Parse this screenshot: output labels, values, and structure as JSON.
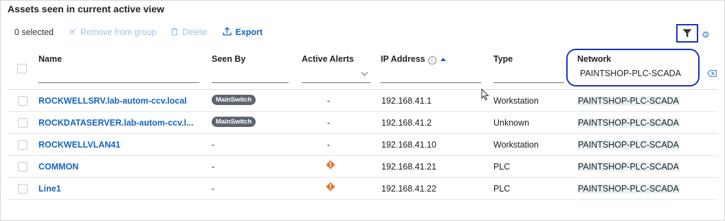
{
  "panel": {
    "title": "Assets seen in current active view"
  },
  "toolbar": {
    "selected": "0 selected",
    "remove_label": "Remove from group",
    "delete_label": "Delete",
    "export_label": "Export"
  },
  "columns": {
    "name": "Name",
    "seen_by": "Seen By",
    "active_alerts": "Active Alerts",
    "ip_address": "IP Address",
    "type": "Type",
    "network": "Network"
  },
  "filters": {
    "network_value": "PAINTSHOP-PLC-SCADA"
  },
  "rows": [
    {
      "name": "ROCKWELLSRV.lab-autom-ccv.local",
      "seen_by": "MainSwitch",
      "alerts": "-",
      "ip": "192.168.41.1",
      "type": "Workstation",
      "network": "PAINTSHOP-PLC-SCADA"
    },
    {
      "name": "ROCKDATASERVER.lab-autom-ccv.l...",
      "seen_by": "MainSwitch",
      "alerts": "-",
      "ip": "192.168.41.2",
      "type": "Unknown",
      "network": "PAINTSHOP-PLC-SCADA"
    },
    {
      "name": "ROCKWELLVLAN41",
      "seen_by": "-",
      "alerts": "-",
      "ip": "192.168.41.10",
      "type": "Workstation",
      "network": "PAINTSHOP-PLC-SCADA"
    },
    {
      "name": "COMMON",
      "seen_by": "-",
      "alerts": "alert-icon",
      "ip": "192.168.41.21",
      "type": "PLC",
      "network": "PAINTSHOP-PLC-SCADA"
    },
    {
      "name": "Line1",
      "seen_by": "-",
      "alerts": "alert-icon",
      "ip": "192.168.41.22",
      "type": "PLC",
      "network": "PAINTSHOP-PLC-SCADA"
    }
  ],
  "colors": {
    "accent": "#1565c0",
    "highlight_outline": "#1032c8",
    "badge": "#5f6570",
    "alert": "#e8722c"
  }
}
